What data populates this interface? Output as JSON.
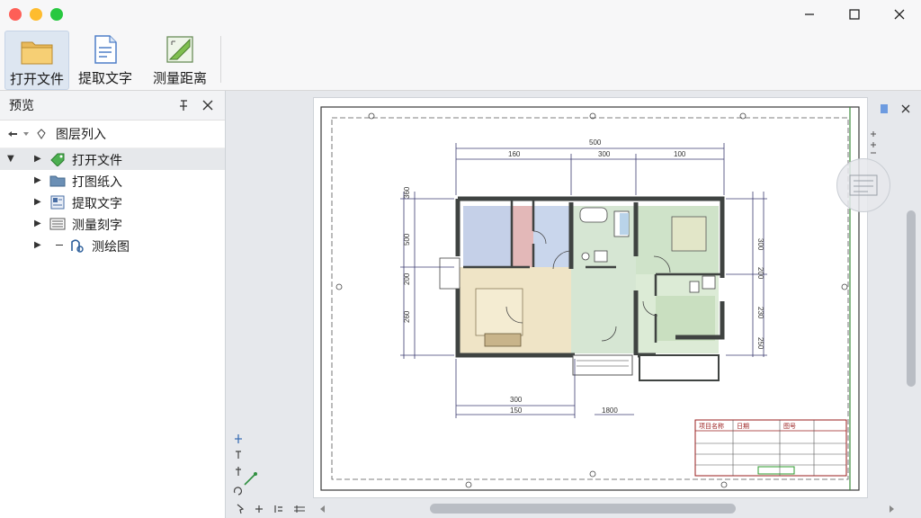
{
  "window": {
    "traffic_lights": [
      "close",
      "minimize",
      "zoom"
    ],
    "controls": [
      "minimize-icon",
      "maximize-icon",
      "close-icon"
    ]
  },
  "toolbar": {
    "buttons": [
      {
        "label": "打开文件",
        "icon": "folder-icon",
        "active": true
      },
      {
        "label": "提取文字",
        "icon": "document-text-icon",
        "active": false
      },
      {
        "label": "测量距离",
        "icon": "ruler-measure-icon",
        "active": false
      }
    ]
  },
  "panel": {
    "title": "预览",
    "breadcrumb": "图层列入",
    "items": [
      {
        "label": "打开文件",
        "icon": "tag-icon",
        "expanded": true,
        "selected": true
      },
      {
        "label": "打图纸入",
        "icon": "folder-icon",
        "expanded": false,
        "selected": false
      },
      {
        "label": "提取文字",
        "icon": "grid-doc-icon",
        "expanded": false,
        "selected": false
      },
      {
        "label": "测量刻字",
        "icon": "list-icon",
        "expanded": false,
        "selected": false
      },
      {
        "label": "测绘图",
        "icon": "measure-tool-icon",
        "expanded": false,
        "selected": false
      }
    ]
  },
  "drawing": {
    "dims_top": [
      "500",
      "160",
      "300",
      "100"
    ],
    "dims_bottom": [
      "300",
      "150",
      "1800"
    ],
    "dims_left": [
      "360",
      "500",
      "200",
      "260"
    ],
    "dims_right": [
      "300",
      "200",
      "230",
      "250"
    ],
    "titleblock": [
      "项目名称",
      "日期",
      "图号"
    ]
  },
  "colors": {
    "accent": "#dde6f1",
    "room_blue": "#c5d0e8",
    "room_red": "#e3b8b8",
    "room_green": "#cfe3c9",
    "room_tan": "#efe4c6",
    "wall": "#3f4341"
  }
}
